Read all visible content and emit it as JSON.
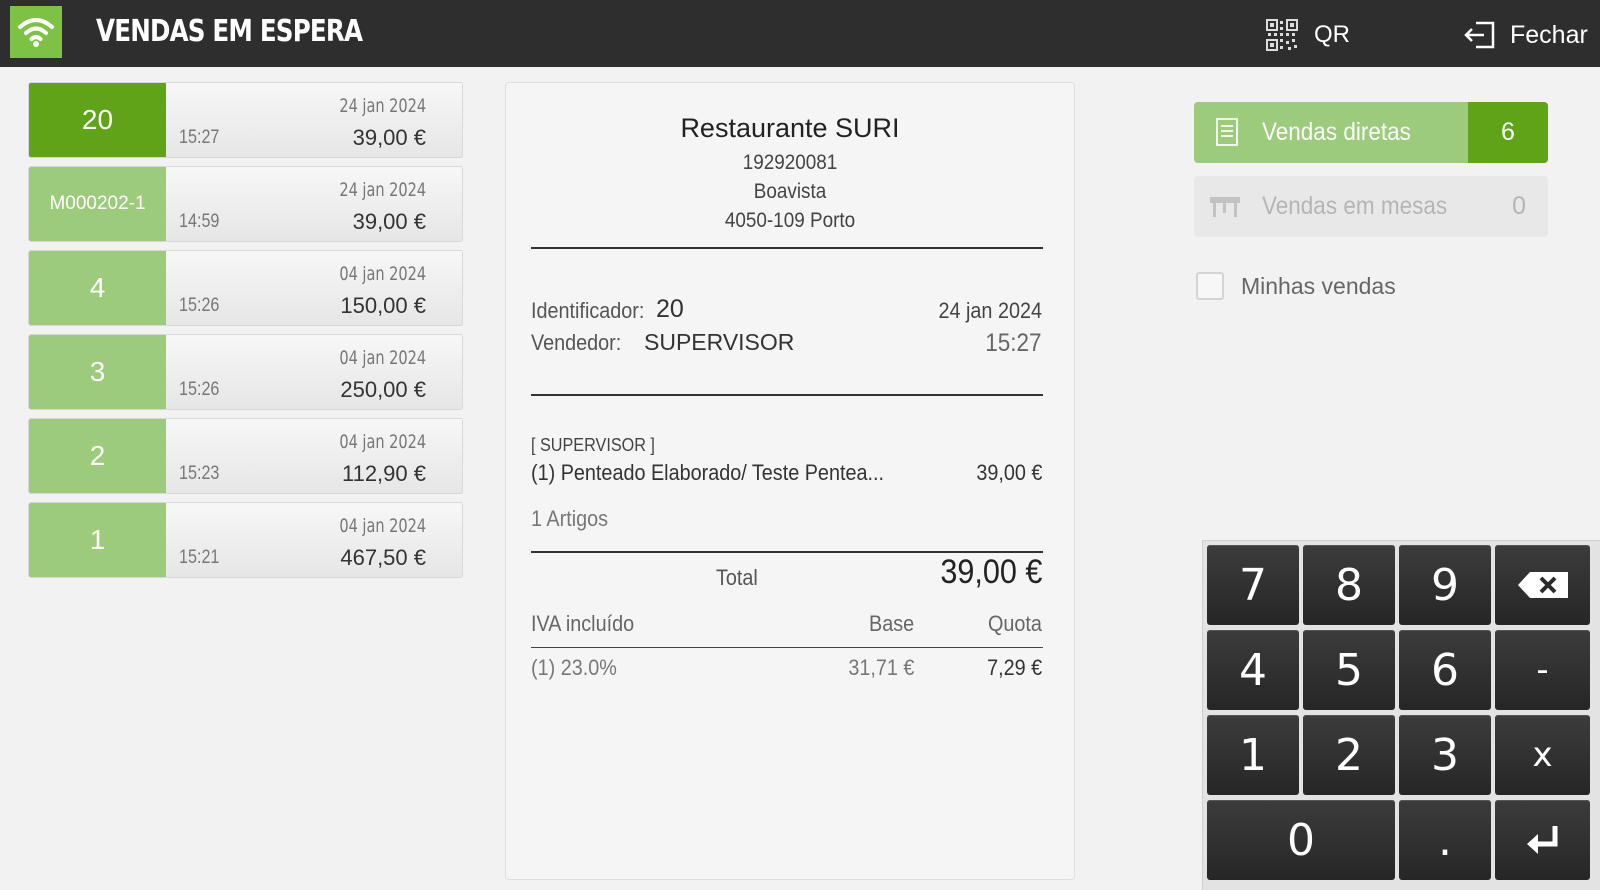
{
  "header": {
    "title": "VENDAS EM ESPERA",
    "qr_label": "QR",
    "close_label": "Fechar"
  },
  "sales": [
    {
      "id": "20",
      "date": "24 jan 2024",
      "time": "15:27",
      "amount": "39,00 €",
      "selected": true
    },
    {
      "id": "M000202-1",
      "date": "24 jan 2024",
      "time": "14:59",
      "amount": "39,00 €",
      "selected": false
    },
    {
      "id": "4",
      "date": "04 jan 2024",
      "time": "15:26",
      "amount": "150,00 €",
      "selected": false
    },
    {
      "id": "3",
      "date": "04 jan 2024",
      "time": "15:26",
      "amount": "250,00 €",
      "selected": false
    },
    {
      "id": "2",
      "date": "04 jan 2024",
      "time": "15:23",
      "amount": "112,90 €",
      "selected": false
    },
    {
      "id": "1",
      "date": "04 jan 2024",
      "time": "15:21",
      "amount": "467,50 €",
      "selected": false
    }
  ],
  "receipt": {
    "store_name": "Restaurante SURI",
    "tax_id": "192920081",
    "address_line": "Boavista",
    "postal": "4050-109 Porto",
    "identifier_label": "Identificador:",
    "identifier_value": "20",
    "date": "24 jan 2024",
    "seller_label": "Vendedor:",
    "seller_value": "SUPERVISOR",
    "time": "15:27",
    "group_label": "[ SUPERVISOR ]",
    "item_desc": "(1) Penteado Elaborado/ Teste Pentea...",
    "item_price": "39,00 €",
    "items_count": "1 Artigos",
    "total_label": "Total",
    "total_value": "39,00 €",
    "tax_header": "IVA incluído",
    "base_header": "Base",
    "quota_header": "Quota",
    "tax_rate": "(1) 23.0%",
    "tax_base": "31,71 €",
    "tax_quota": "7,29 €"
  },
  "right_panel": {
    "direct_sales_label": "Vendas diretas",
    "direct_sales_count": "6",
    "table_sales_label": "Vendas em mesas",
    "table_sales_count": "0",
    "my_sales_label": "Minhas vendas"
  },
  "keypad": {
    "keys": [
      "7",
      "8",
      "9",
      "4",
      "5",
      "6",
      "-",
      "1",
      "2",
      "3",
      "x",
      "0",
      "."
    ]
  },
  "colors": {
    "header_bg": "#2e2e2e",
    "accent_green": "#5ea318",
    "light_green": "#9ccb7c",
    "wifi_green": "#7dc242"
  }
}
